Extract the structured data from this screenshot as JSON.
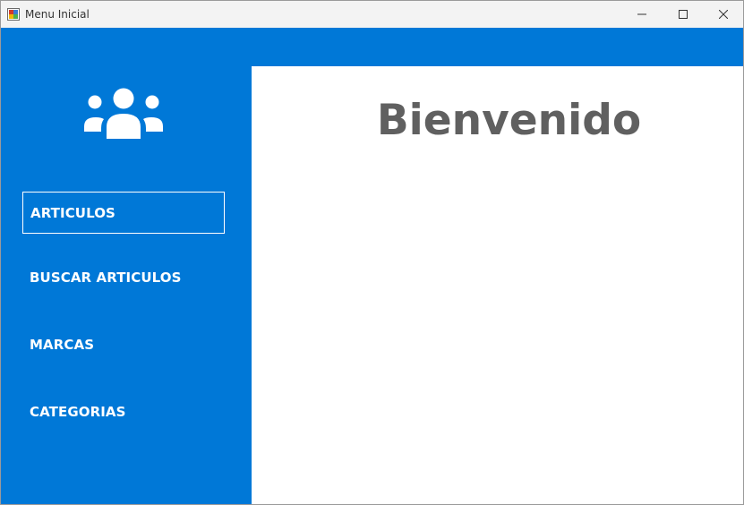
{
  "window": {
    "title": "Menu Inicial",
    "controls": {
      "minimize_icon": "minimize-icon",
      "maximize_icon": "maximize-icon",
      "close_icon": "close-icon"
    }
  },
  "colors": {
    "accent": "#0078d7",
    "welcome_text": "#606060",
    "titlebar": "#f3f3f3"
  },
  "sidebar": {
    "logo_icon": "users-group-icon",
    "items": [
      {
        "label": "ARTICULOS",
        "active": true
      },
      {
        "label": "BUSCAR ARTICULOS",
        "active": false
      },
      {
        "label": "MARCAS",
        "active": false
      },
      {
        "label": "CATEGORIAS",
        "active": false
      }
    ]
  },
  "main": {
    "welcome": "Bienvenido"
  }
}
